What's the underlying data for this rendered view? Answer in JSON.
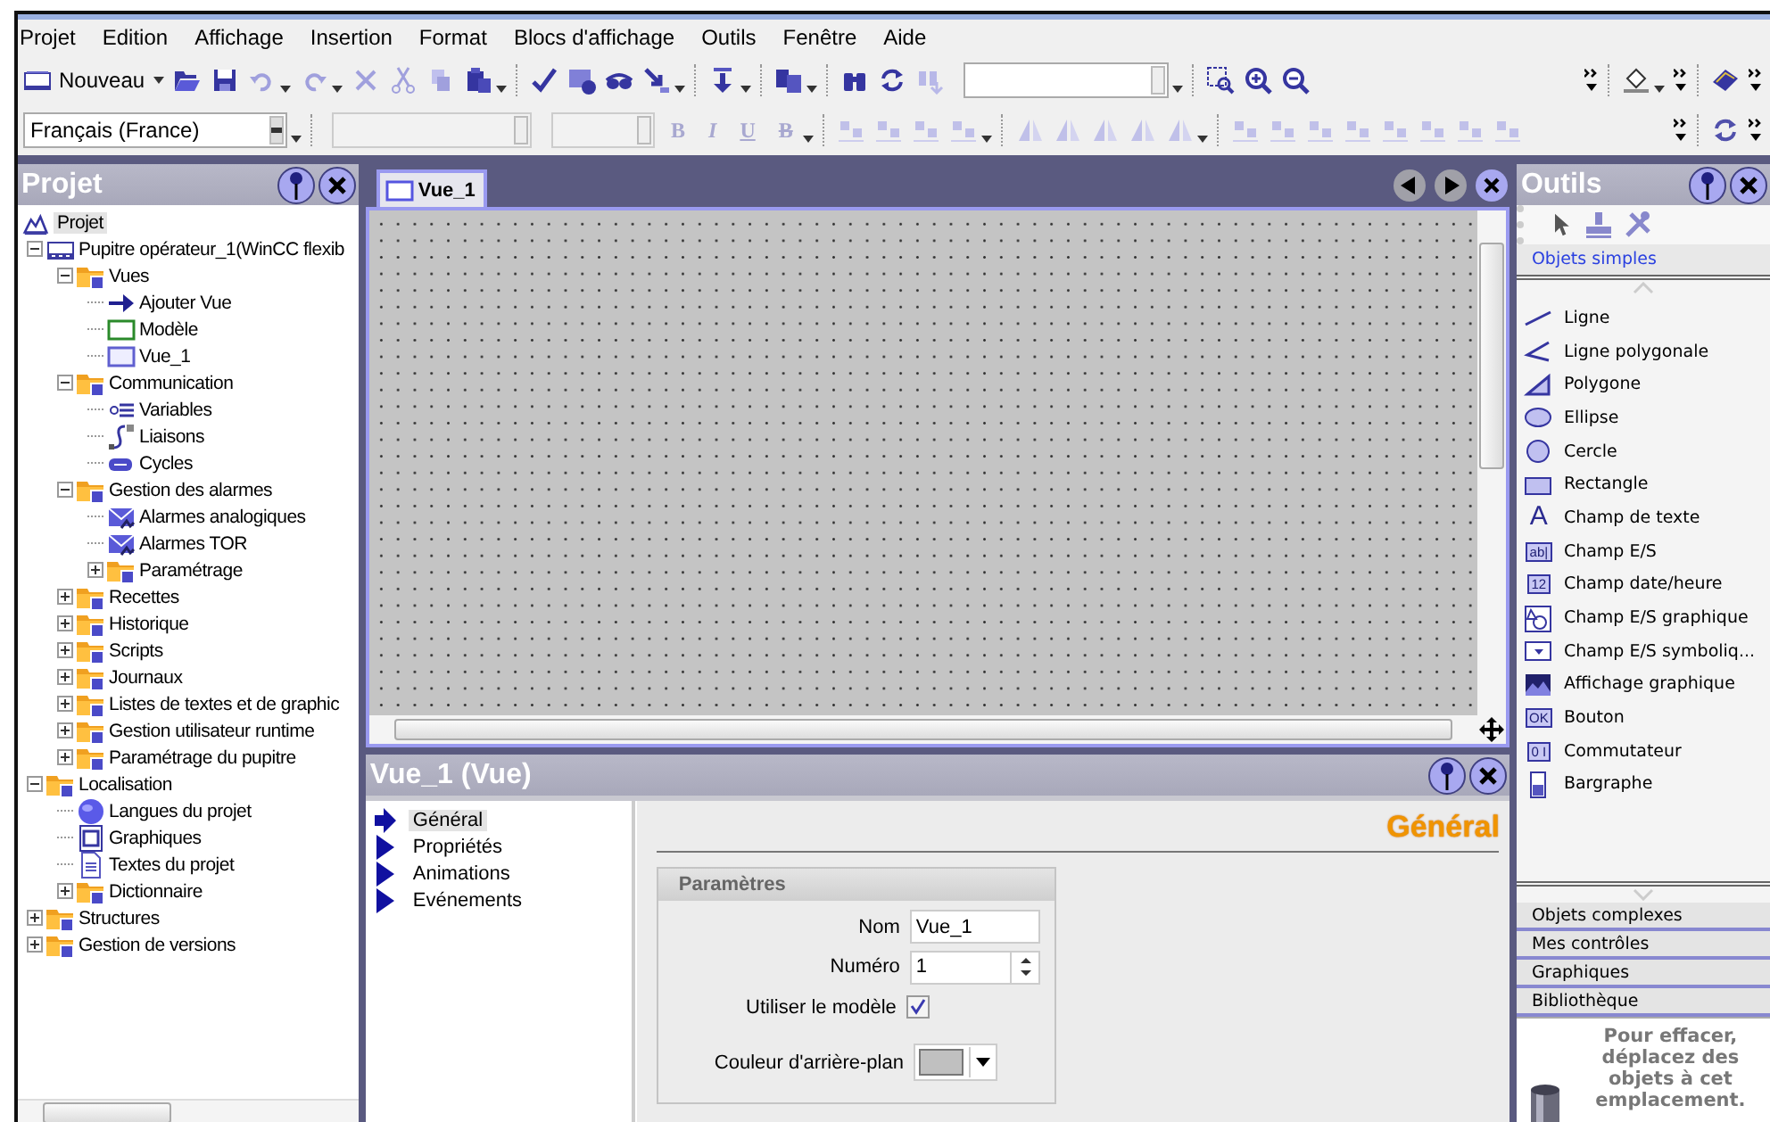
{
  "menu": [
    "Projet",
    "Edition",
    "Affichage",
    "Insertion",
    "Format",
    "Blocs d'affichage",
    "Outils",
    "Fenêtre",
    "Aide"
  ],
  "toolbar": {
    "new_label": "Nouveau",
    "language": "Français (France)",
    "format_buttons": [
      "B",
      "I",
      "U",
      "B"
    ]
  },
  "project_panel": {
    "title": "Projet",
    "root": {
      "label": "Projet",
      "selected": true
    },
    "tree": [
      {
        "label": "Pupitre opérateur_1(WinCC flexib",
        "kind": "device",
        "expanded": true,
        "children": [
          {
            "label": "Vues",
            "kind": "folder",
            "expanded": true,
            "children": [
              {
                "label": "Ajouter Vue",
                "kind": "add"
              },
              {
                "label": "Modèle",
                "kind": "template"
              },
              {
                "label": "Vue_1",
                "kind": "screen"
              }
            ]
          },
          {
            "label": "Communication",
            "kind": "folder",
            "expanded": true,
            "children": [
              {
                "label": "Variables",
                "kind": "tags"
              },
              {
                "label": "Liaisons",
                "kind": "connection"
              },
              {
                "label": "Cycles",
                "kind": "cycle"
              }
            ]
          },
          {
            "label": "Gestion des alarmes",
            "kind": "folder",
            "expanded": true,
            "children": [
              {
                "label": "Alarmes analogiques",
                "kind": "alarm"
              },
              {
                "label": "Alarmes TOR",
                "kind": "alarm"
              },
              {
                "label": "Paramétrage",
                "kind": "folder",
                "expanded": false
              }
            ]
          },
          {
            "label": "Recettes",
            "kind": "folder",
            "expanded": false
          },
          {
            "label": "Historique",
            "kind": "folder",
            "expanded": false
          },
          {
            "label": "Scripts",
            "kind": "folder",
            "expanded": false
          },
          {
            "label": "Journaux",
            "kind": "folder",
            "expanded": false
          },
          {
            "label": "Listes de textes et de graphic",
            "kind": "folder",
            "expanded": false
          },
          {
            "label": "Gestion utilisateur runtime",
            "kind": "folder",
            "expanded": false
          },
          {
            "label": "Paramétrage du pupitre",
            "kind": "folder",
            "expanded": false
          }
        ]
      },
      {
        "label": "Localisation",
        "kind": "folder",
        "expanded": true,
        "children": [
          {
            "label": "Langues du projet",
            "kind": "globe"
          },
          {
            "label": "Graphiques",
            "kind": "image"
          },
          {
            "label": "Textes du projet",
            "kind": "doc"
          },
          {
            "label": "Dictionnaire",
            "kind": "folder",
            "expanded": false
          }
        ]
      },
      {
        "label": "Structures",
        "kind": "folder",
        "expanded": false
      },
      {
        "label": "Gestion de versions",
        "kind": "folder",
        "expanded": false
      }
    ]
  },
  "editor": {
    "tabs": [
      {
        "label": "Vue_1",
        "selected": true
      }
    ]
  },
  "properties": {
    "title": "Vue_1 (Vue)",
    "nav": [
      {
        "label": "Général",
        "selected": true
      },
      {
        "label": "Propriétés",
        "selected": false
      },
      {
        "label": "Animations",
        "selected": false
      },
      {
        "label": "Evénements",
        "selected": false
      }
    ],
    "heading": "Général",
    "group": "Paramètres",
    "fields": [
      {
        "kind": "text",
        "label": "Nom",
        "value": "Vue_1"
      },
      {
        "kind": "spin",
        "label": "Numéro",
        "value": "1"
      },
      {
        "kind": "check",
        "label": "Utiliser le modèle",
        "checked": true
      },
      {
        "kind": "color",
        "label": "Couleur d'arrière-plan"
      }
    ]
  },
  "tools_panel": {
    "title": "Outils",
    "section": "Objets simples",
    "items": [
      {
        "label": "Ligne",
        "kind": "line"
      },
      {
        "label": "Ligne polygonale",
        "kind": "polyline"
      },
      {
        "label": "Polygone",
        "kind": "polygon"
      },
      {
        "label": "Ellipse",
        "kind": "ellipse"
      },
      {
        "label": "Cercle",
        "kind": "circle"
      },
      {
        "label": "Rectangle",
        "kind": "rectangle"
      },
      {
        "label": "Champ de texte",
        "kind": "glyph",
        "glyph": "A"
      },
      {
        "label": "Champ E/S",
        "kind": "glyphbox",
        "glyph": "ab|"
      },
      {
        "label": "Champ date/heure",
        "kind": "glyphbox",
        "glyph": "12"
      },
      {
        "label": "Champ E/S graphique",
        "kind": "graphicio"
      },
      {
        "label": "Champ E/S symboliq...",
        "kind": "dropdown"
      },
      {
        "label": "Affichage graphique",
        "kind": "picture"
      },
      {
        "label": "Bouton",
        "kind": "glyphbox",
        "glyph": "OK"
      },
      {
        "label": "Commutateur",
        "kind": "glyphbox",
        "glyph": "0 I"
      },
      {
        "label": "Bargraphe",
        "kind": "bar"
      }
    ],
    "sections": [
      "Objets complexes",
      "Mes contrôles",
      "Graphiques",
      "Bibliothèque"
    ],
    "hint": "Pour effacer, déplacez des objets à cet emplacement."
  }
}
